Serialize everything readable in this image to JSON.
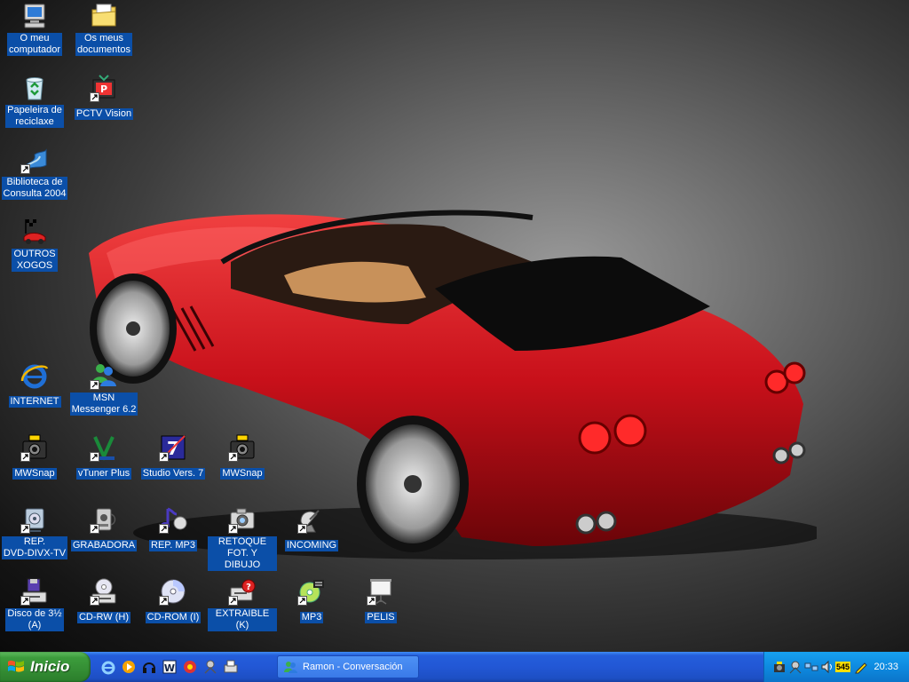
{
  "desktop": {
    "icons": [
      {
        "label": "O meu\ncomputador",
        "icon": "my-computer-icon"
      },
      {
        "label": "Os meus\ndocumentos",
        "icon": "my-documents-icon"
      },
      {
        "label": "Papeleira de\nreciclaxe",
        "icon": "recycle-bin-icon"
      },
      {
        "label": "PCTV Vision",
        "icon": "pctv-icon"
      },
      {
        "label": "Biblioteca de\nConsulta 2004",
        "icon": "library-icon"
      },
      {
        "label": "OUTROS\nXOGOS",
        "icon": "games-icon"
      },
      {
        "label": "INTERNET",
        "icon": "internet-explorer-icon"
      },
      {
        "label": "MSN\nMessenger 6.2",
        "icon": "msn-messenger-icon"
      },
      {
        "label": "MWSnap",
        "icon": "mwsnap-icon"
      },
      {
        "label": "vTuner Plus",
        "icon": "vtuner-icon"
      },
      {
        "label": "Studio Vers. 7",
        "icon": "studio-icon"
      },
      {
        "label": "MWSnap",
        "icon": "mwsnap-icon"
      },
      {
        "label": "REP.\nDVD-DIVX-TV",
        "icon": "dvd-player-icon"
      },
      {
        "label": "GRABADORA",
        "icon": "recorder-icon"
      },
      {
        "label": "REP. MP3",
        "icon": "music-note-icon"
      },
      {
        "label": "RETOQUE\nFOT. Y DIBUJO",
        "icon": "camera-icon"
      },
      {
        "label": "INCOMING",
        "icon": "satellite-dish-icon"
      },
      {
        "label": "Disco de 3½\n(A)",
        "icon": "floppy-drive-icon"
      },
      {
        "label": "CD-RW (H)",
        "icon": "cd-rw-drive-icon"
      },
      {
        "label": "CD-ROM (I)",
        "icon": "cd-rom-icon"
      },
      {
        "label": "EXTRAIBLE (K)",
        "icon": "removable-drive-icon"
      },
      {
        "label": "MP3",
        "icon": "mp3-cd-icon"
      },
      {
        "label": "PELIS",
        "icon": "projector-screen-icon"
      }
    ]
  },
  "taskbar": {
    "start_label": "Inicio",
    "quick_launch": [
      "internet-explorer-icon",
      "media-player-icon",
      "headset-icon",
      "word-icon",
      "media-icon",
      "network-icon",
      "fax-icon"
    ],
    "window_button_label": "Ramon - Conversación",
    "tray_badge": "545",
    "clock": "20:33"
  },
  "colors": {
    "label_bg": "#0b4fa8",
    "taskbar_blue": "#245edb",
    "start_green": "#3c9c3c",
    "car_red": "#c8101a"
  }
}
